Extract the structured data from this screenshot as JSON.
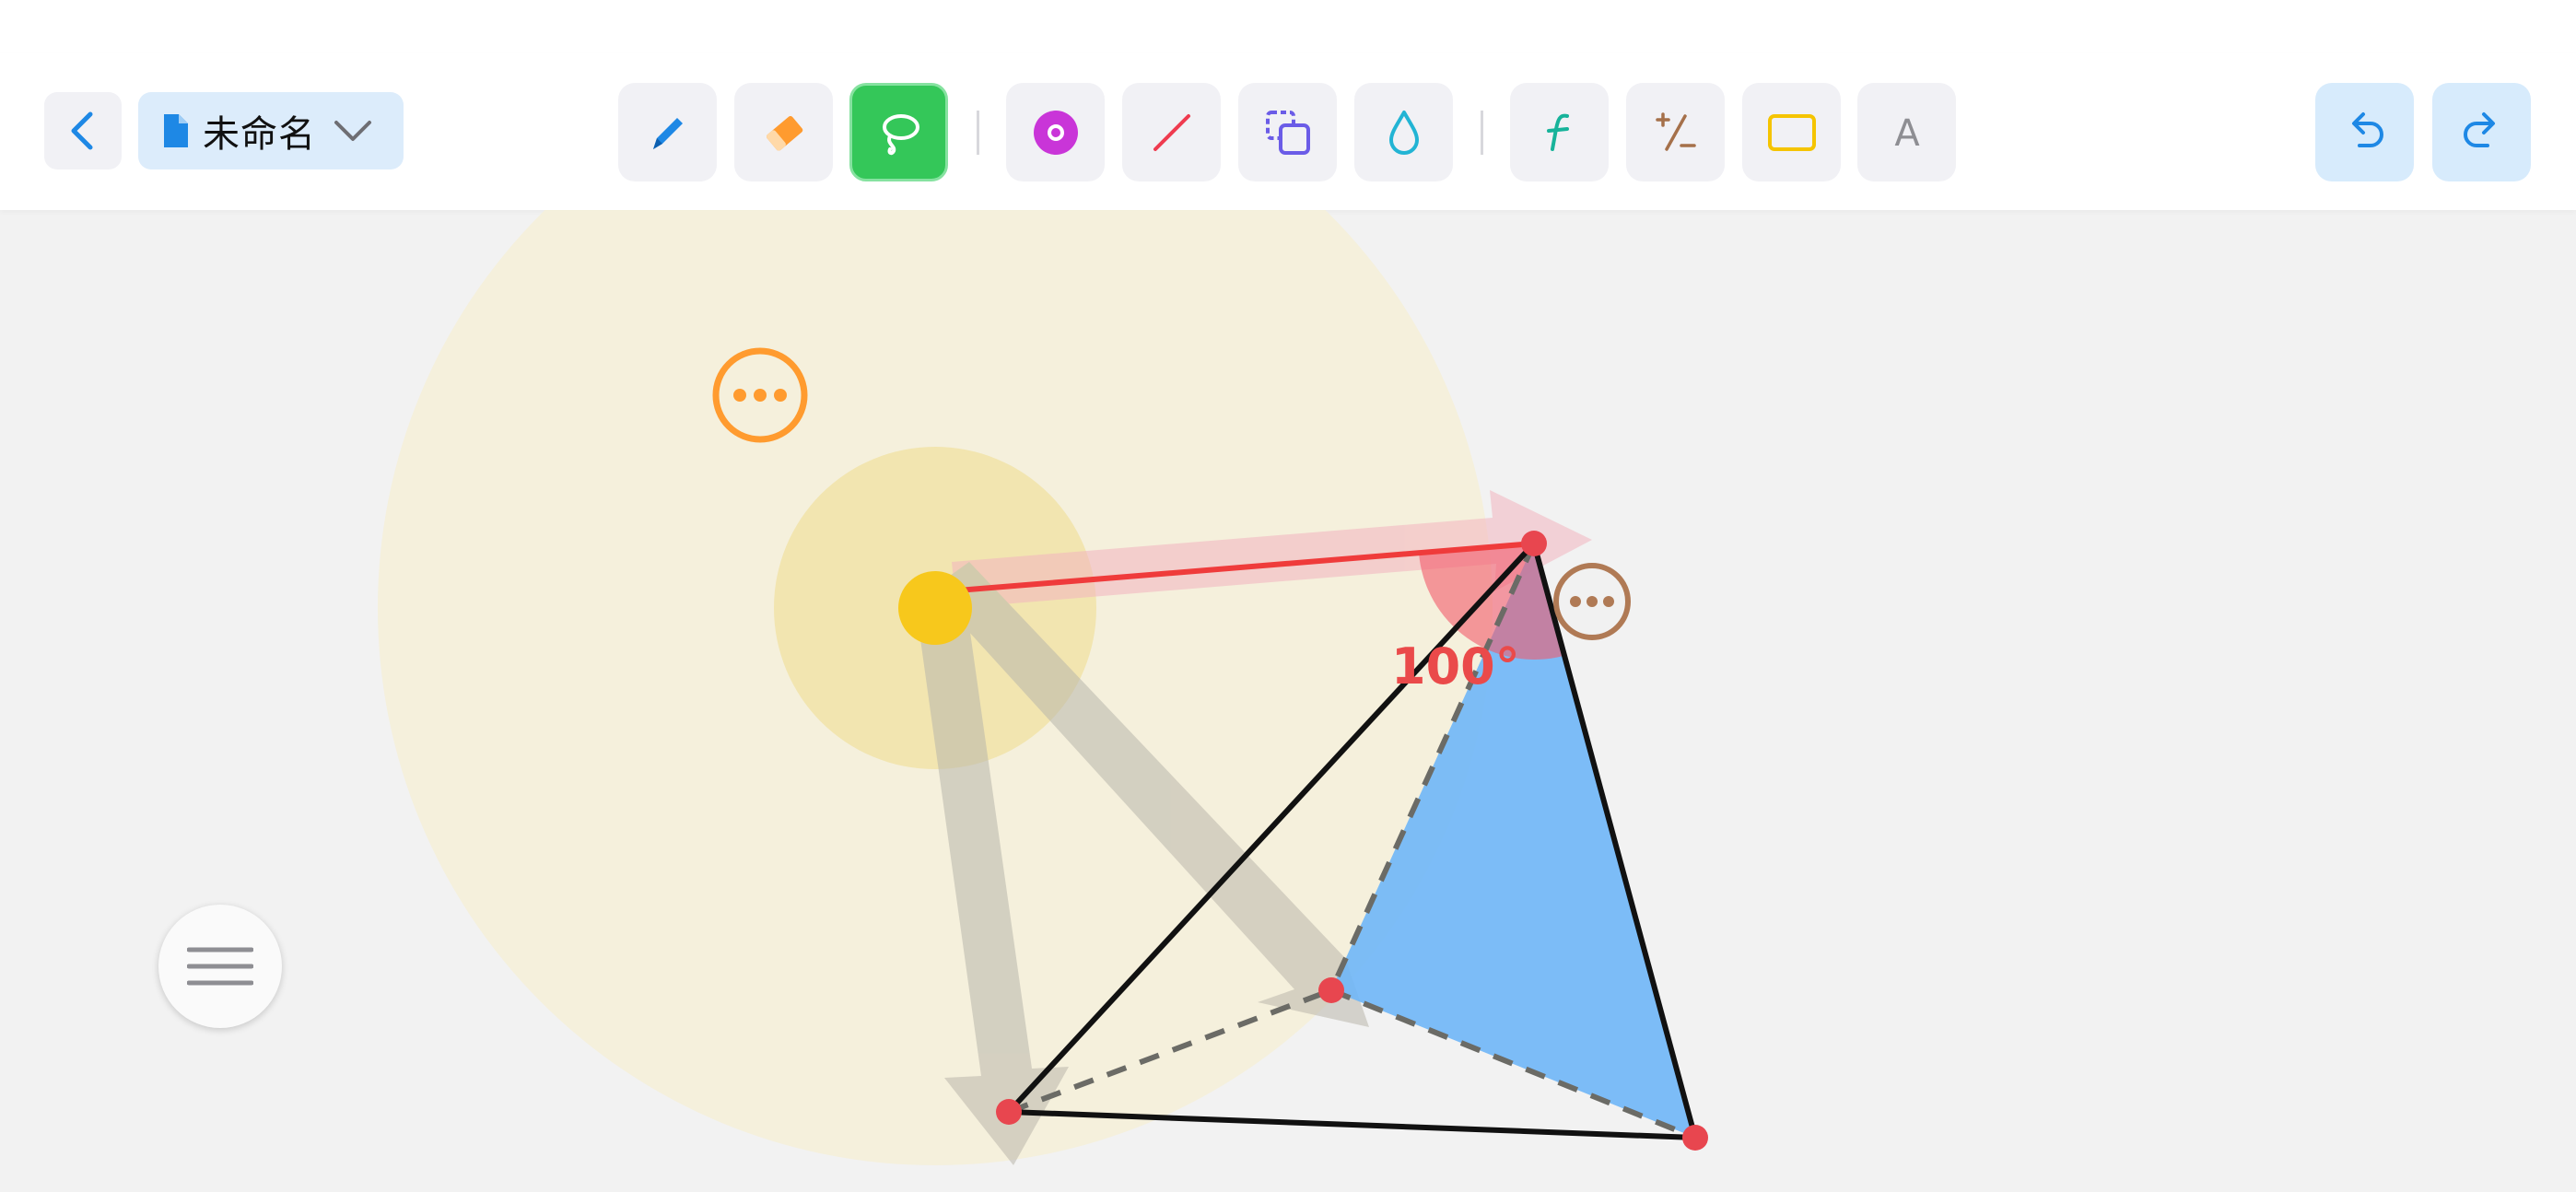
{
  "document": {
    "title": "未命名"
  },
  "canvas": {
    "angle_label": "100°"
  },
  "colors": {
    "accent_blue": "#1e88e5",
    "lasso_green": "#34c759",
    "eraser_orange": "#ff9b2f",
    "point_magenta": "#c935d8",
    "line_red": "#ef3b4f",
    "copy_purple": "#6b5ce7",
    "drop_cyan": "#22b4d4",
    "function_teal": "#17b39a",
    "plusminus_brown": "#a5704a",
    "rect_yellow": "#f5c400",
    "text_gray": "#8e8e93",
    "triangle_fill": "#6fb6f7",
    "vertex_red": "#e8464f"
  },
  "toolbar": {
    "tools": [
      {
        "name": "pen",
        "icon": "pencil-icon"
      },
      {
        "name": "eraser",
        "icon": "eraser-icon"
      },
      {
        "name": "lasso",
        "icon": "lasso-icon",
        "active": true
      },
      {
        "name": "point",
        "icon": "point-icon"
      },
      {
        "name": "line",
        "icon": "line-icon"
      },
      {
        "name": "duplicate",
        "icon": "copy-icon"
      },
      {
        "name": "fill",
        "icon": "drop-icon"
      },
      {
        "name": "function",
        "icon": "function-icon"
      },
      {
        "name": "plus-minus",
        "icon": "plus-minus-icon"
      },
      {
        "name": "rectangle",
        "icon": "rectangle-icon"
      },
      {
        "name": "text",
        "icon": "text-icon",
        "glyph": "A"
      }
    ]
  }
}
